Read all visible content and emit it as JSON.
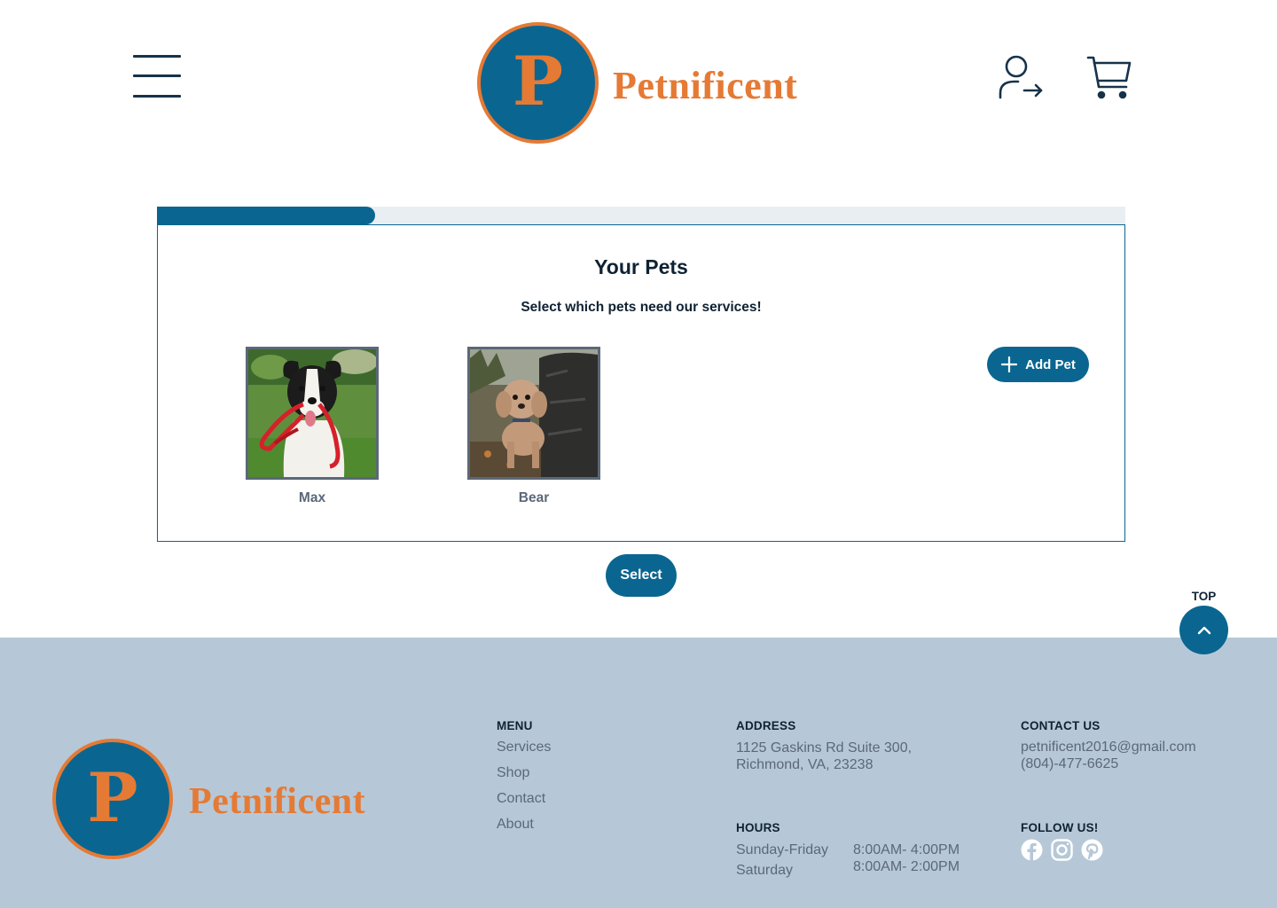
{
  "header": {
    "brand_letter": "P",
    "brand_name": "Petnificent"
  },
  "progress": {
    "completed_fraction": 0.225
  },
  "pets_card": {
    "title": "Your Pets",
    "subtitle": "Select which pets need our services!",
    "pets": [
      {
        "name": "Max"
      },
      {
        "name": "Bear"
      }
    ],
    "add_pet_label": "Add Pet"
  },
  "select_label": "Select",
  "scroll_top_label": "TOP",
  "footer": {
    "brand_letter": "P",
    "brand_name": "Petnificent",
    "menu": {
      "heading": "MENU",
      "items": [
        "Services",
        "Shop",
        "Contact",
        "About"
      ]
    },
    "address": {
      "heading": "ADDRESS",
      "line1": "1125 Gaskins Rd Suite 300,",
      "line2": "Richmond, VA, 23238"
    },
    "hours": {
      "heading": "HOURS",
      "rows": [
        {
          "days": "Sunday-Friday",
          "time": "8:00AM- 4:00PM"
        },
        {
          "days": "Saturday",
          "time": "8:00AM- 2:00PM"
        }
      ]
    },
    "contact": {
      "heading": "CONTACT US",
      "email": "petnificent2016@gmail.com",
      "phone": "(804)-477-6625"
    },
    "follow": {
      "heading": "FOLLOW US!",
      "icons": [
        "facebook-icon",
        "instagram-icon",
        "pinterest-icon"
      ]
    }
  },
  "colors": {
    "primary": "#0a6690",
    "accent": "#e57a35",
    "footer_bg": "#b6c8d7",
    "text_dark": "#0f2233",
    "text_muted": "#5b6878"
  }
}
